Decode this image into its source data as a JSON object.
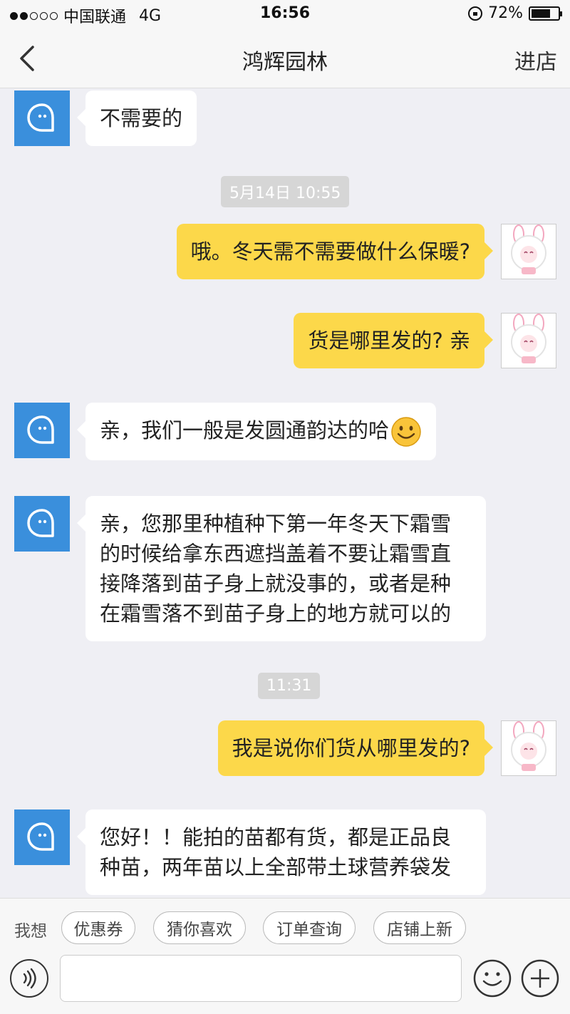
{
  "status_bar": {
    "carrier": "中国联通",
    "network": "4G",
    "time": "16:56",
    "battery_percent": "72%",
    "battery_level": 0.72
  },
  "nav": {
    "title": "鸿辉园林",
    "right_action": "进店"
  },
  "messages": [
    {
      "side": "shop",
      "text": "不需要的"
    },
    {
      "timestamp": "5月14日 10:55"
    },
    {
      "side": "user",
      "text": "哦。冬天需不需要做什么保暖?"
    },
    {
      "side": "user",
      "text": "货是哪里发的? 亲"
    },
    {
      "side": "shop",
      "text": "亲，我们一般是发圆通韵达的哈",
      "emoji": "smile-emoji"
    },
    {
      "side": "shop",
      "lines": [
        "亲，您那里种植种下第一年冬天下霜雪",
        "的时候给拿东西遮挡盖着不要让霜雪直",
        "接降落到苗子身上就没事的，或者是种",
        "在霜雪落不到苗子身上的地方就可以的"
      ]
    },
    {
      "timestamp": "11:31"
    },
    {
      "side": "user",
      "text": "我是说你们货从哪里发的?"
    },
    {
      "side": "shop",
      "lines": [
        "您好！！能拍的苗都有货，都是正品良",
        "种苗，两年苗以上全部带土球营养袋发"
      ]
    }
  ],
  "quick_bar": {
    "label": "我想",
    "chips": [
      "优惠券",
      "猜你喜欢",
      "订单查询",
      "店铺上新"
    ]
  },
  "colors": {
    "user_bubble": "#fcd84a",
    "shop_avatar": "#3a8fdc",
    "background": "#efeff4"
  },
  "icons": {
    "back": "chevron-left-icon",
    "voice": "voice-icon",
    "emoji": "smile-icon",
    "plus": "plus-icon"
  }
}
